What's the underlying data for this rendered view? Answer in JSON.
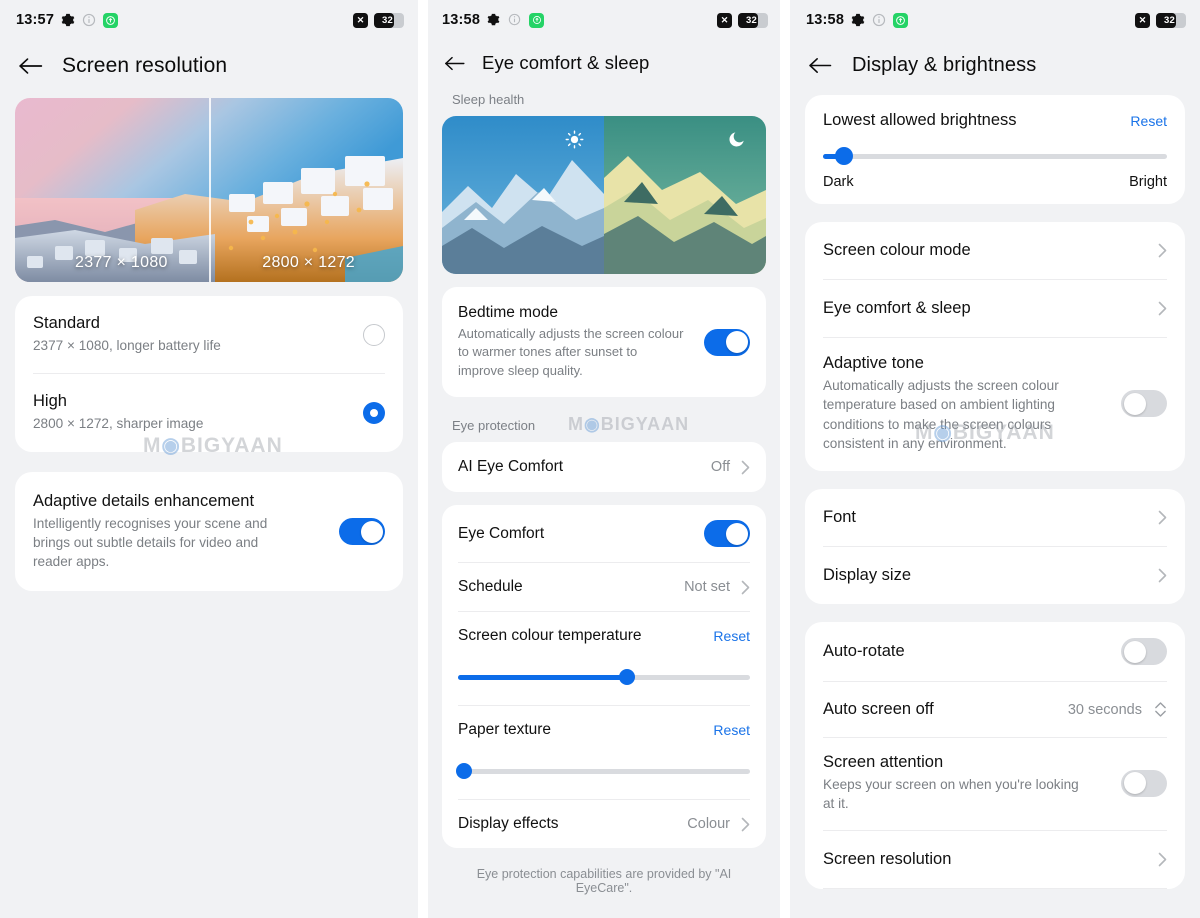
{
  "watermark": "M◎BIGYAAN",
  "accent": "#0c6ce9",
  "link_color": "#1a73e8",
  "panels": [
    {
      "status": {
        "time": "13:57",
        "icons": [
          "gear-icon",
          "info-icon",
          "green-app-icon"
        ],
        "mute_glyph": "✕",
        "battery_percent": "32"
      },
      "title": "Screen resolution",
      "preview": {
        "label_left": "2377 × 1080",
        "label_right": "2800 × 1272"
      },
      "options": [
        {
          "title": "Standard",
          "sub": "2377 × 1080, longer battery life",
          "selected": false
        },
        {
          "title": "High",
          "sub": "2800 × 1272, sharper image",
          "selected": true
        }
      ],
      "adaptive": {
        "title": "Adaptive details enhancement",
        "sub": "Intelligently recognises your scene and brings out subtle details for video and reader apps.",
        "toggle_on": true
      }
    },
    {
      "status": {
        "time": "13:58",
        "mute_glyph": "✕",
        "battery_percent": "32"
      },
      "title": "Eye comfort & sleep",
      "group_sleep": "Sleep health",
      "bedtime": {
        "title": "Bedtime mode",
        "sub": "Automatically adjusts the screen colour to warmer tones after sunset to improve sleep quality.",
        "toggle_on": true
      },
      "group_eye": "Eye protection",
      "ai_eye_comfort": {
        "title": "AI Eye Comfort",
        "value": "Off"
      },
      "eye_comfort": {
        "title": "Eye Comfort",
        "toggle_on": true
      },
      "schedule": {
        "title": "Schedule",
        "value": "Not set"
      },
      "colour_temperature": {
        "title": "Screen colour temperature",
        "reset": "Reset",
        "value_percent": 58
      },
      "paper_texture": {
        "title": "Paper texture",
        "reset": "Reset",
        "value_percent": 2
      },
      "display_effects": {
        "title": "Display effects",
        "value": "Colour"
      },
      "footnote": "Eye protection capabilities are provided by \"AI EyeCare\"."
    },
    {
      "status": {
        "time": "13:58",
        "mute_glyph": "✕",
        "battery_percent": "32"
      },
      "title": "Display & brightness",
      "lowest_brightness": {
        "title": "Lowest allowed brightness",
        "reset": "Reset",
        "value_percent": 6,
        "label_min": "Dark",
        "label_max": "Bright"
      },
      "group2": [
        {
          "title": "Screen colour mode",
          "type": "chevron"
        },
        {
          "title": "Eye comfort & sleep",
          "type": "chevron"
        }
      ],
      "adaptive_tone": {
        "title": "Adaptive tone",
        "sub": "Automatically adjusts the screen colour temperature based on ambient lighting conditions to make the screen colours consistent in any environment.",
        "toggle_on": false
      },
      "group3": [
        {
          "title": "Font",
          "type": "chevron"
        },
        {
          "title": "Display size",
          "type": "chevron"
        }
      ],
      "auto_rotate": {
        "title": "Auto-rotate",
        "toggle_on": false
      },
      "auto_screen_off": {
        "title": "Auto screen off",
        "value": "30 seconds"
      },
      "screen_attention": {
        "title": "Screen attention",
        "sub": "Keeps your screen on when you're looking at it.",
        "toggle_on": false
      },
      "screen_resolution": {
        "title": "Screen resolution",
        "type": "chevron"
      }
    }
  ]
}
